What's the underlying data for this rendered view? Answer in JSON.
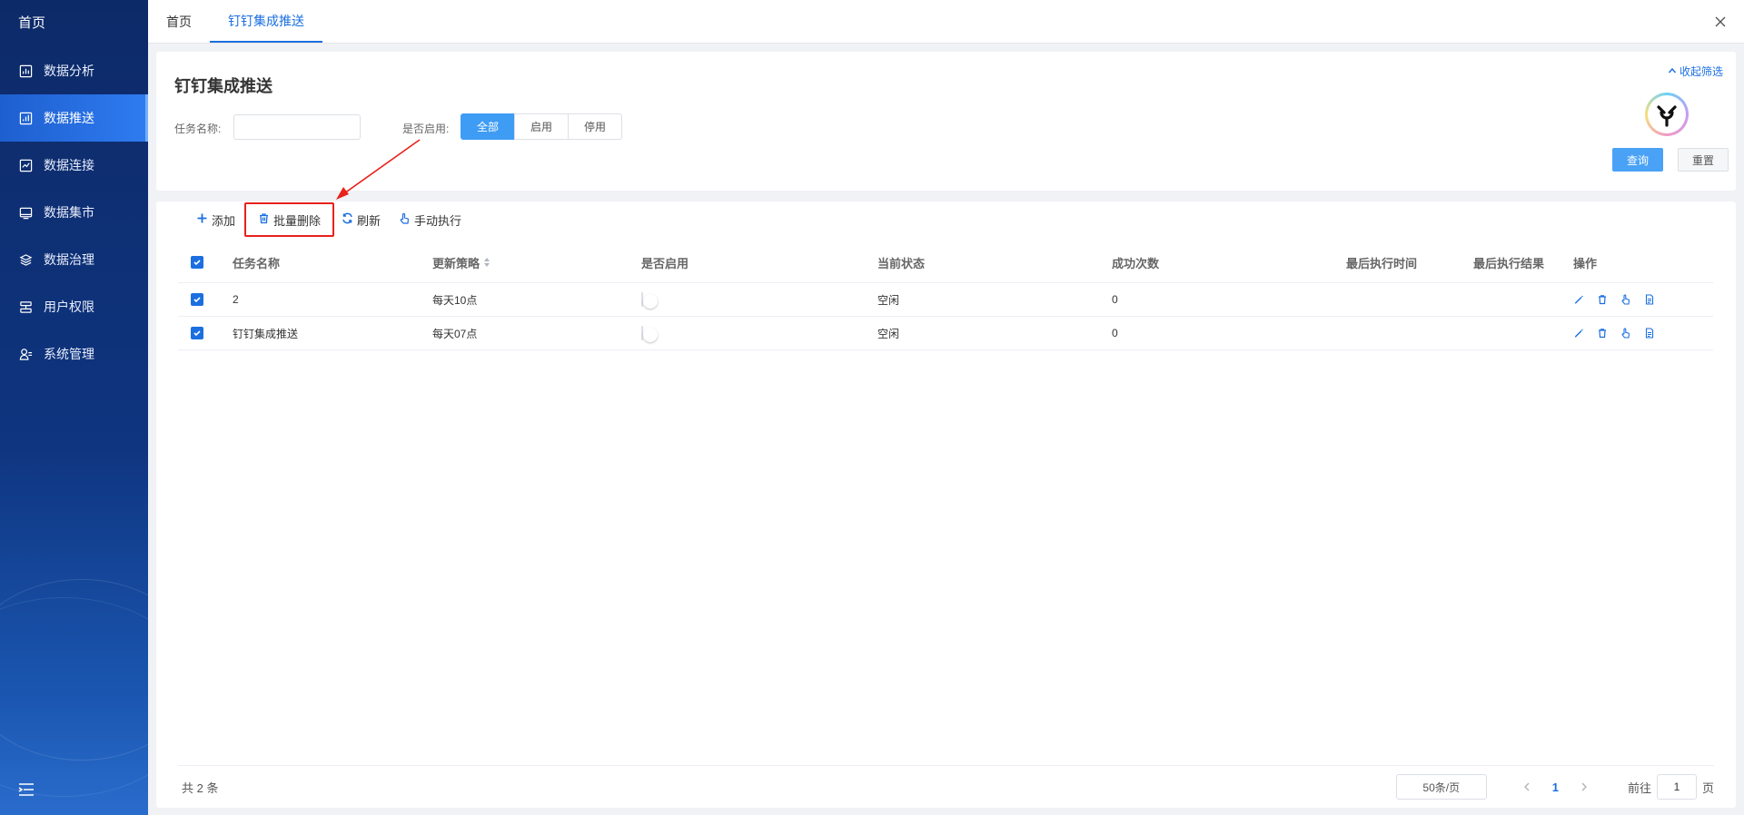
{
  "sidebar": {
    "home": "首页",
    "items": [
      {
        "label": "数据分析",
        "icon": "chart-icon"
      },
      {
        "label": "数据推送",
        "icon": "push-icon",
        "active": true
      },
      {
        "label": "数据连接",
        "icon": "connection-icon"
      },
      {
        "label": "数据集市",
        "icon": "market-icon"
      },
      {
        "label": "数据治理",
        "icon": "layers-icon"
      },
      {
        "label": "用户权限",
        "icon": "users-icon"
      },
      {
        "label": "系统管理",
        "icon": "settings-icon"
      }
    ]
  },
  "tabs": [
    {
      "label": "首页"
    },
    {
      "label": "钉钉集成推送",
      "active": true
    }
  ],
  "filter": {
    "title": "钉钉集成推送",
    "collapse_label": "收起筛选",
    "task_name_label": "任务名称:",
    "task_name_value": "",
    "enabled_label": "是否启用:",
    "enabled_options": [
      "全部",
      "启用",
      "停用"
    ],
    "enabled_selected": "全部",
    "query_label": "查询",
    "reset_label": "重置"
  },
  "toolbar": {
    "add": "添加",
    "batch_delete": "批量删除",
    "refresh": "刷新",
    "manual_run": "手动执行"
  },
  "table": {
    "columns": [
      "任务名称",
      "更新策略",
      "是否启用",
      "当前状态",
      "成功次数",
      "最后执行时间",
      "最后执行结果",
      "操作"
    ],
    "rows": [
      {
        "name": "2",
        "strategy": "每天10点",
        "enabled": false,
        "state": "空闲",
        "success": "0",
        "last_time": "",
        "last_result": ""
      },
      {
        "name": "钉钉集成推送",
        "strategy": "每天07点",
        "enabled": false,
        "state": "空闲",
        "success": "0",
        "last_time": "",
        "last_result": ""
      }
    ]
  },
  "pagination": {
    "total": "共 2 条",
    "page_size": "50条/页",
    "current_page": "1",
    "goto_label": "前往",
    "goto_value": "1",
    "page_suffix": "页"
  },
  "colors": {
    "accent": "#1b6fe0",
    "highlight_box": "#e8211c",
    "sidebar_bg": "#0f3580"
  }
}
